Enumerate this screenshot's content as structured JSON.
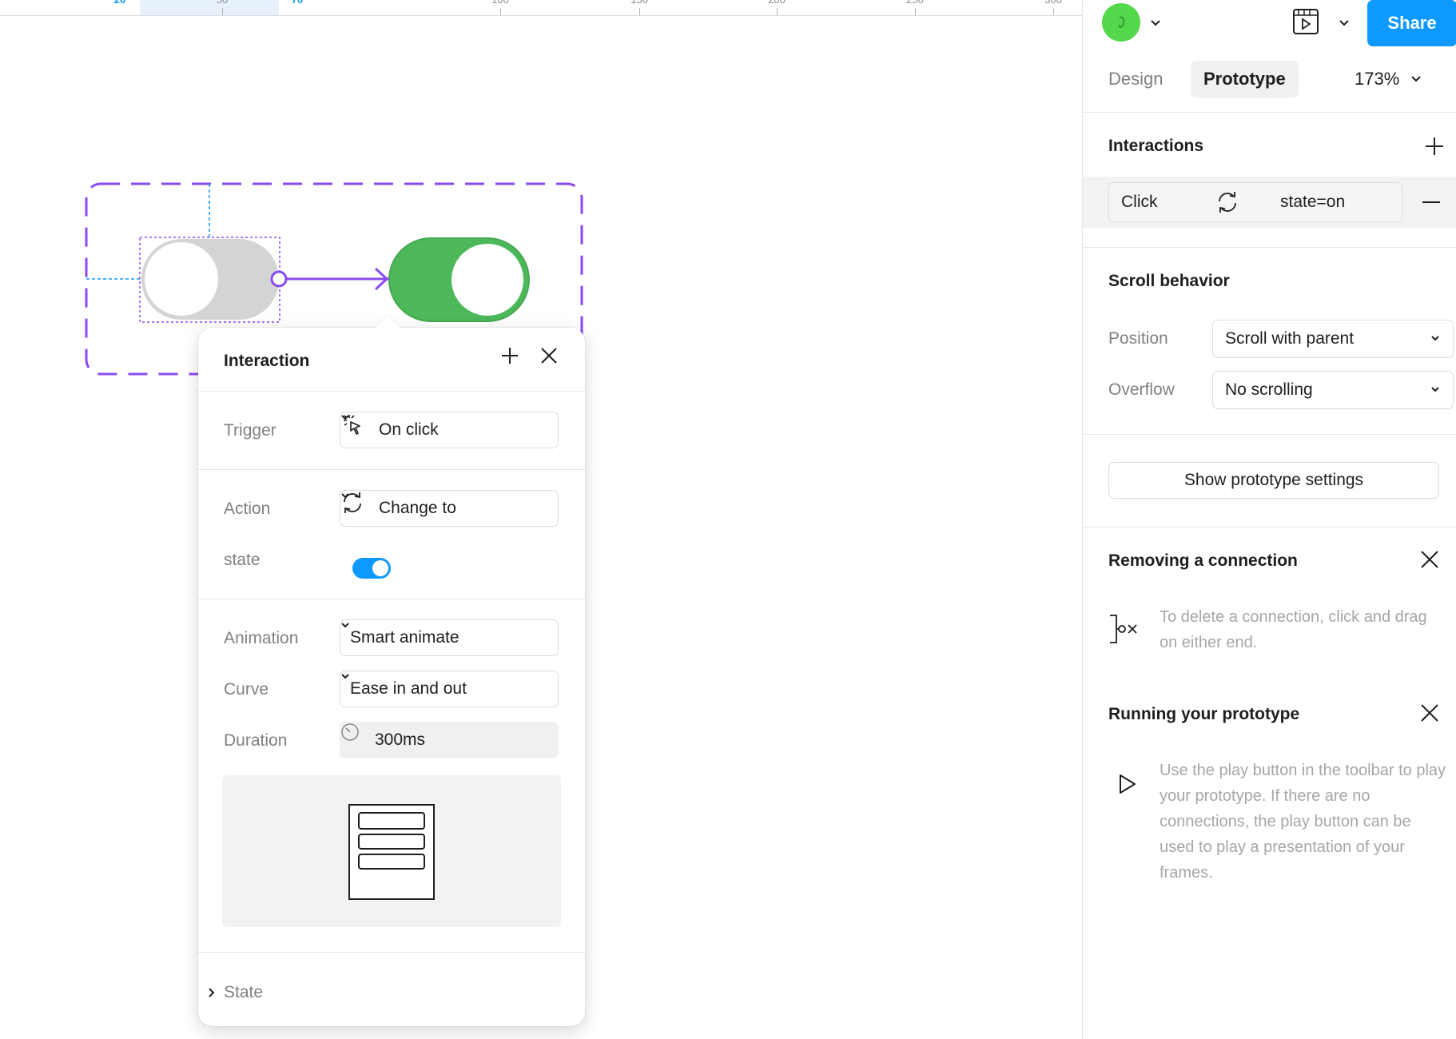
{
  "ruler": {
    "labels": [
      "20",
      "50",
      "70",
      "100",
      "150",
      "200",
      "250",
      "300"
    ]
  },
  "popover": {
    "title": "Interaction",
    "trigger": {
      "label": "Trigger",
      "value": "On click"
    },
    "action": {
      "label": "Action",
      "value": "Change to"
    },
    "state": {
      "label": "state",
      "on": true
    },
    "animation": {
      "label": "Animation",
      "value": "Smart animate"
    },
    "curve": {
      "label": "Curve",
      "value": "Ease in and out"
    },
    "duration": {
      "label": "Duration",
      "value": "300ms"
    },
    "state_section": "State"
  },
  "panel": {
    "share": "Share",
    "tabs": {
      "design": "Design",
      "prototype": "Prototype"
    },
    "zoom": "173%",
    "interactions": {
      "title": "Interactions",
      "item": {
        "trigger": "Click",
        "target": "state=on"
      }
    },
    "scroll": {
      "title": "Scroll behavior",
      "position_label": "Position",
      "position_value": "Scroll with parent",
      "overflow_label": "Overflow",
      "overflow_value": "No scrolling"
    },
    "prototype_settings": "Show prototype settings",
    "removing": {
      "title": "Removing a connection",
      "text": "To delete a connection, click and drag on either end."
    },
    "running": {
      "title": "Running your prototype",
      "text": "Use the play button in the toolbar to play your prototype. If there are no connections, the play button can be used to play a presentation of your frames."
    }
  },
  "colors": {
    "accent": "#0d99ff",
    "prototype_purple": "#8a4af3",
    "toggle_on": "#4cb85a",
    "avatar": "#52d84a"
  }
}
